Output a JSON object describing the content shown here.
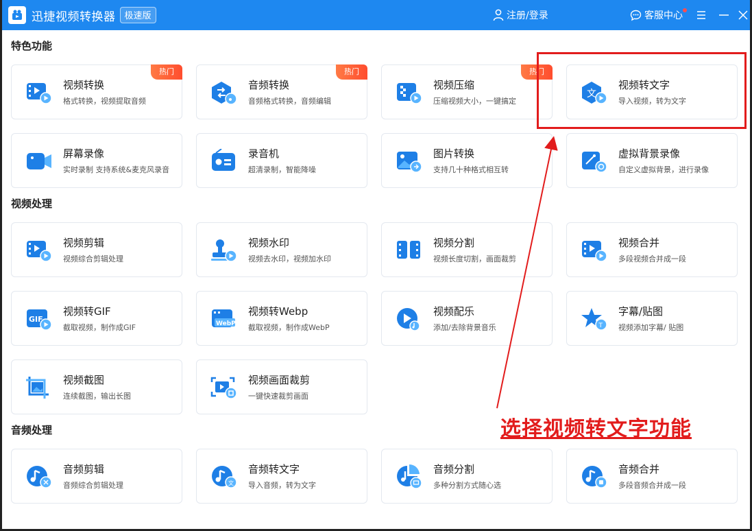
{
  "titlebar": {
    "app_title": "迅捷视频转换器",
    "edition": "极速版",
    "login": "注册/登录",
    "support": "客服中心"
  },
  "sections": [
    {
      "title": "特色功能",
      "items": [
        {
          "title": "视频转换",
          "desc": "格式转换，视频提取音频",
          "hot": "热门",
          "icon": "video-convert-icon"
        },
        {
          "title": "音频转换",
          "desc": "音频格式转换，音频编辑",
          "hot": "热门",
          "icon": "audio-convert-icon"
        },
        {
          "title": "视频压缩",
          "desc": "压缩视频大小，一键搞定",
          "hot": "热门",
          "icon": "video-compress-icon"
        },
        {
          "title": "视频转文字",
          "desc": "导入视频，转为文字",
          "icon": "video-to-text-icon"
        },
        {
          "title": "屏幕录像",
          "desc": "实时录制 支持系统&麦克风录音",
          "icon": "screen-record-icon"
        },
        {
          "title": "录音机",
          "desc": "超清录制，智能降噪",
          "icon": "recorder-icon"
        },
        {
          "title": "图片转换",
          "desc": "支持几十种格式相互转",
          "icon": "image-convert-icon"
        },
        {
          "title": "虚拟背景录像",
          "desc": "自定义虚拟背景，进行录像",
          "icon": "virtual-bg-icon"
        }
      ]
    },
    {
      "title": "视频处理",
      "items": [
        {
          "title": "视频剪辑",
          "desc": "视频综合剪辑处理",
          "icon": "video-edit-icon"
        },
        {
          "title": "视频水印",
          "desc": "视频去水印，视频加水印",
          "icon": "watermark-icon"
        },
        {
          "title": "视频分割",
          "desc": "视频长度切割，画面裁剪",
          "icon": "video-split-icon"
        },
        {
          "title": "视频合并",
          "desc": "多段视频合并成一段",
          "icon": "video-merge-icon"
        },
        {
          "title": "视频转GIF",
          "desc": "截取视频，制作成GIF",
          "icon": "gif-icon",
          "icon_text": "GIF"
        },
        {
          "title": "视频转Webp",
          "desc": "截取视频，制作成WebP",
          "icon": "webp-icon",
          "icon_text": "WebP"
        },
        {
          "title": "视频配乐",
          "desc": "添加/去除背景音乐",
          "icon": "bg-music-icon"
        },
        {
          "title": "字幕/贴图",
          "desc": "视频添加字幕/ 贴图",
          "icon": "subtitle-icon"
        },
        {
          "title": "视频截图",
          "desc": "连续截图，输出长图",
          "icon": "screenshot-icon"
        },
        {
          "title": "视频画面裁剪",
          "desc": "一键快速裁剪画面",
          "icon": "crop-icon"
        }
      ]
    },
    {
      "title": "音频处理",
      "items": [
        {
          "title": "音频剪辑",
          "desc": "音频综合剪辑处理",
          "icon": "audio-edit-icon"
        },
        {
          "title": "音频转文字",
          "desc": "导入音频，转为文字",
          "icon": "audio-to-text-icon"
        },
        {
          "title": "音频分割",
          "desc": "多种分割方式随心选",
          "icon": "audio-split-icon"
        },
        {
          "title": "音频合并",
          "desc": "多段音频合并成一段",
          "icon": "audio-merge-icon"
        }
      ]
    }
  ],
  "annotation": "选择视频转文字功能",
  "colors": {
    "titlebar": "#1e88f0",
    "icon_blue": "#1e7fe6",
    "hot_badge": "#ff5a36",
    "annotation_red": "#e21c1c"
  }
}
